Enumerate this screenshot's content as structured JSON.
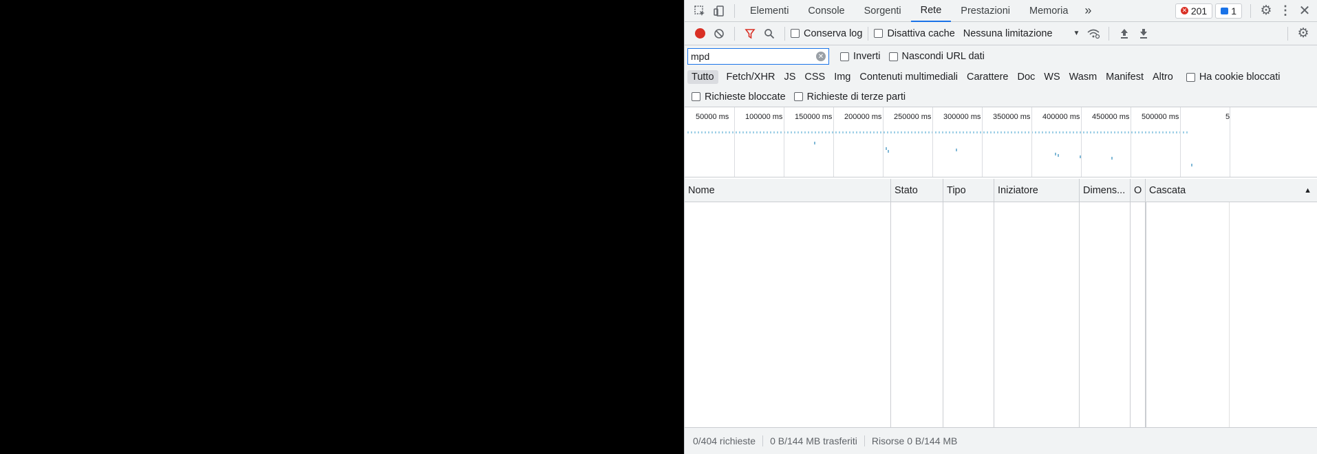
{
  "tabs": {
    "items": [
      "Elementi",
      "Console",
      "Sorgenti",
      "Rete",
      "Prestazioni",
      "Memoria"
    ],
    "active": "Rete",
    "more": "»"
  },
  "badges": {
    "errors": "201",
    "messages": "1"
  },
  "toolbar": {
    "preserve_log": "Conserva log",
    "disable_cache": "Disattiva cache",
    "throttling": "Nessuna limitazione"
  },
  "filter": {
    "value": "mpd",
    "invert": "Inverti",
    "hide_data_urls": "Nascondi URL dati"
  },
  "types": [
    "Tutto",
    "Fetch/XHR",
    "JS",
    "CSS",
    "Img",
    "Contenuti multimediali",
    "Carattere",
    "Doc",
    "WS",
    "Wasm",
    "Manifest",
    "Altro"
  ],
  "type_active": "Tutto",
  "has_blocked_cookies": "Ha cookie bloccati",
  "blocked_requests": "Richieste bloccate",
  "third_party": "Richieste di terze parti",
  "overview_ticks": [
    "50000 ms",
    "100000 ms",
    "150000 ms",
    "200000 ms",
    "250000 ms",
    "300000 ms",
    "350000 ms",
    "400000 ms",
    "450000 ms",
    "500000 ms",
    "5"
  ],
  "columns": [
    "Nome",
    "Stato",
    "Tipo",
    "Iniziatore",
    "Dimens...",
    "O",
    "Cascata"
  ],
  "status": {
    "requests": "0/404 richieste",
    "transferred": "0 B/144 MB trasferiti",
    "resources": "Risorse 0 B/144 MB"
  },
  "colors": {
    "accent": "#1a73e8",
    "record": "#d93025",
    "error": "#d93025"
  }
}
